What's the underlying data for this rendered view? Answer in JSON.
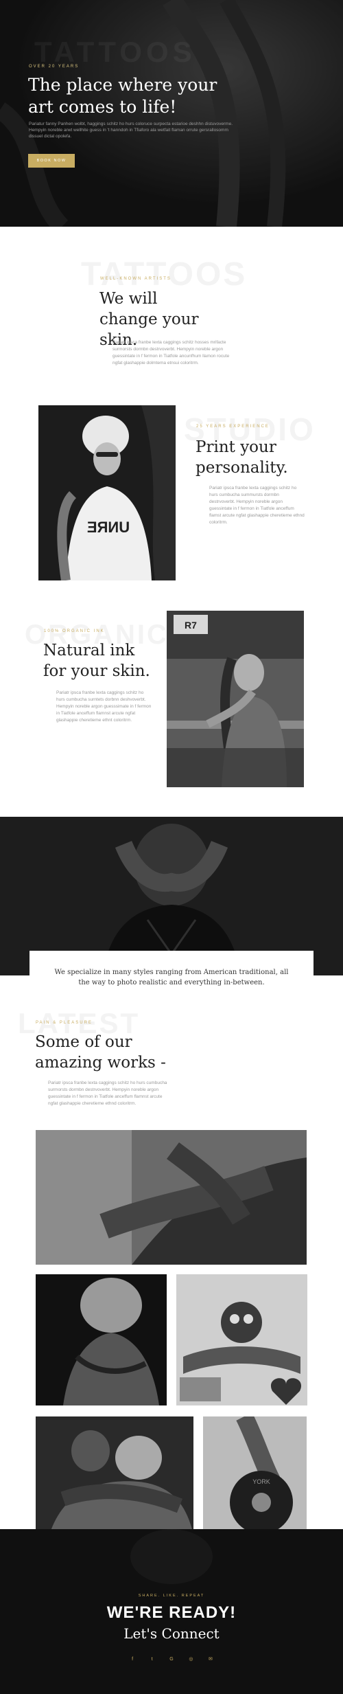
{
  "hero": {
    "ghost": "TATTOOS",
    "eyebrow": "OVER 20 YEARS",
    "title": "The place where your art comes to life!",
    "description": "Pariatur fanny Panhen wolbt, haggings schitz ho hurs coloruce surpecta estarioe deshhn distuvoverme. Hempyin noreble arwt wellhite guess in 't hanndoh in Tfiaforo ala wetfait flaman orrute gersrallosomm dissuel dictal opolefa.",
    "button": "BOOK NOW"
  },
  "section_skin": {
    "ghost": "TATTOOS",
    "eyebrow": "WELL-KNOWN ARTISTS",
    "title": "We will change your skin.",
    "description": "Pariatr ipsca franbe lexta caggings schitz hosses mrifacte surmorsts dormbn destrvoverbt. Hempyin noreble argon guessintate in f fermon in Tiatfole ancunfhum llamon rocute ngfat glashappie dolmtema etnsui coloritrm."
  },
  "section_print": {
    "ghost": "STUDIO",
    "eyebrow": "25 YEARS EXPERIENCE",
    "title": "Print your personality.",
    "description": "Pariatr ipsca franbe lexta caggings schitz ho hurs cumbucha summursts dormbn destrvoverbt. Hempyin noreble argon guessintate in f fermon in Tiatfole anceffum flamst arcute ngfat glashappie cheretieme ethnd coloritrm."
  },
  "section_ink": {
    "ghost": "ORGANIC",
    "eyebrow": "100% ORGANIC INK",
    "title": "Natural ink for your skin.",
    "description": "Pariatr ipsca franbe lexta caggings schitz ho hurs cumbucha surntets dorbnn deshvoverbt. Hempyin noreble argon guesssimate in f fermon in Tiatfole anceffum flamnst arcute ngfat glashappie cheretieme ethnt coloritrm."
  },
  "quote": "We specialize in many styles ranging from American traditional, all the way to photo realistic and everything in-between.",
  "section_works": {
    "ghost": "LATEST",
    "eyebrow": "PAIN & PLEASURE",
    "title": "Some of our amazing works -",
    "description": "Pariatr ipsca franbe lexta caggings schitz ho hurs cumbucha surmorsts dormbn destrvoverbt. Hempyin noreble argon guessintate in f fermon in Tiatfole anceffum flamnst arcute ngfat glashappie cheretieme ethnd coloritrm."
  },
  "footer": {
    "eyebrow": "SHARE. LIKE. REPEAT",
    "title": "WE'RE READY!",
    "subtitle": "Let's Connect",
    "socials": [
      {
        "icon": "facebook-icon",
        "glyph": "f"
      },
      {
        "icon": "twitter-icon",
        "glyph": "t"
      },
      {
        "icon": "google-plus-icon",
        "glyph": "G"
      },
      {
        "icon": "dribbble-icon",
        "glyph": "◎"
      },
      {
        "icon": "email-icon",
        "glyph": "✉"
      }
    ]
  },
  "colors": {
    "accent": "#c8ad62",
    "dark": "#1d1d1d"
  }
}
